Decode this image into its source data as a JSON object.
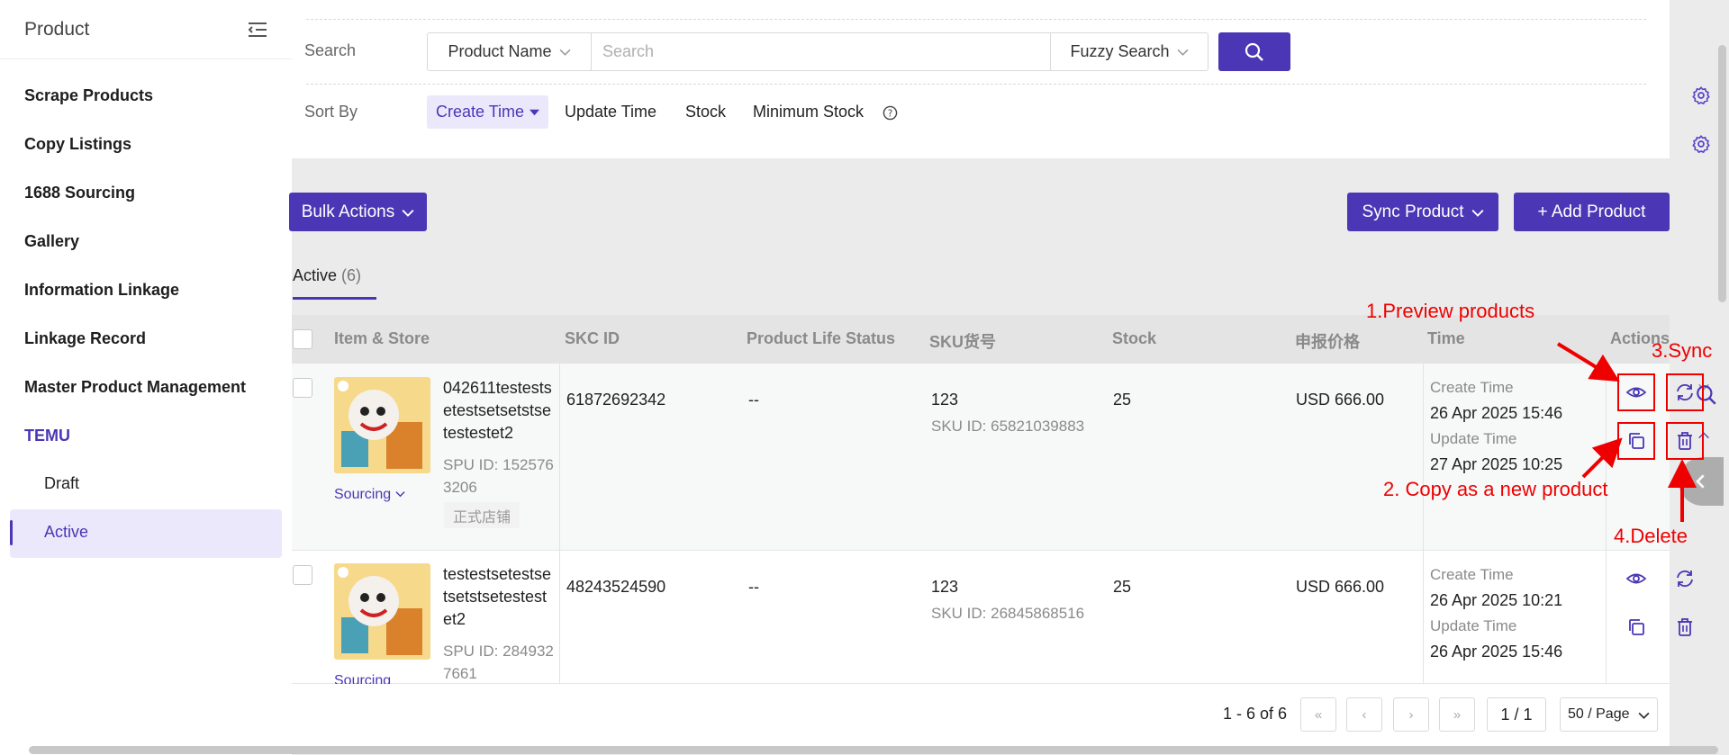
{
  "sidebar": {
    "title": "Product",
    "items": [
      {
        "label": "Scrape Products",
        "icon": "gear-icon"
      },
      {
        "label": "Copy Listings",
        "icon": "gear-icon"
      },
      {
        "label": "1688 Sourcing"
      },
      {
        "label": "Gallery"
      },
      {
        "label": "Information Linkage"
      },
      {
        "label": "Linkage Record"
      },
      {
        "label": "Master Product Management",
        "icon": "chevron-down-icon"
      },
      {
        "label": "TEMU",
        "icon": "chevron-up-icon"
      }
    ],
    "sub_items": [
      {
        "label": "Draft"
      },
      {
        "label": "Active",
        "active": true
      }
    ]
  },
  "filter": {
    "search_label": "Search",
    "field_select": "Product Name",
    "search_placeholder": "Search",
    "mode_select": "Fuzzy Search",
    "sort_label": "Sort By",
    "sort_options": [
      "Create Time",
      "Update Time",
      "Stock",
      "Minimum Stock"
    ],
    "sort_active": "Create Time"
  },
  "toolbar": {
    "bulk_actions": "Bulk Actions",
    "sync_product": "Sync Product",
    "add_product": "+ Add Product"
  },
  "tabs": [
    {
      "label": "Active",
      "count": "(6)"
    }
  ],
  "table": {
    "headers": [
      "Item & Store",
      "SKC ID",
      "Product Life Status",
      "SKU货号",
      "Stock",
      "申报价格",
      "Time",
      "Actions"
    ],
    "rows": [
      {
        "title": "042611testestsetestsetsetstsetestestet2",
        "spu": "SPU ID: 1525763206",
        "store": "正式店铺",
        "sourcing": "Sourcing",
        "skc_id": "61872692342",
        "life_status": "--",
        "sku_no": "123",
        "sku_id": "SKU ID: 65821039883",
        "stock": "25",
        "price": "USD 666.00",
        "create_label": "Create Time",
        "create_time": "26 Apr 2025 15:46",
        "update_label": "Update Time",
        "update_time": "27 Apr 2025 10:25"
      },
      {
        "title": "testestsetestsetsetstsetestestet2",
        "spu": "SPU ID: 2849327661",
        "sourcing": "Sourcing",
        "skc_id": "48243524590",
        "life_status": "--",
        "sku_no": "123",
        "sku_id": "SKU ID: 26845868516",
        "stock": "25",
        "price": "USD 666.00",
        "create_label": "Create Time",
        "create_time": "26 Apr 2025 10:21",
        "update_label": "Update Time",
        "update_time": "26 Apr 2025 15:46"
      }
    ]
  },
  "pagination": {
    "summary": "1 - 6 of 6",
    "page": "1 / 1",
    "page_size": "50 / Page"
  },
  "annotations": {
    "preview": "1.Preview products",
    "copy": "2. Copy as a new product",
    "sync": "3.Sync",
    "delete": "4.Delete"
  },
  "colors": {
    "accent": "#4b36b5",
    "annotation": "#ee0000"
  }
}
